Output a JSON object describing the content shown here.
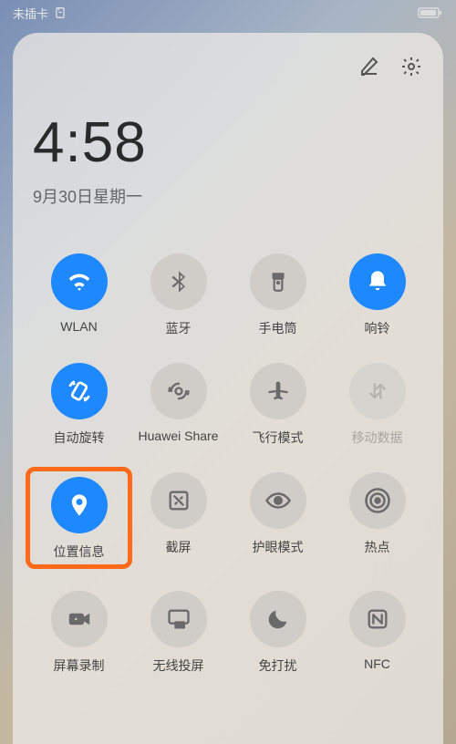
{
  "status": {
    "carrier": "未插卡",
    "battery_pct": 85
  },
  "panel": {
    "time": "4:58",
    "date": "9月30日星期一"
  },
  "toggles": [
    {
      "label": "WLAN",
      "icon": "wifi",
      "active": true,
      "dim": false,
      "highlight": false
    },
    {
      "label": "蓝牙",
      "icon": "bluetooth",
      "active": false,
      "dim": false,
      "highlight": false
    },
    {
      "label": "手电筒",
      "icon": "flashlight",
      "active": false,
      "dim": false,
      "highlight": false
    },
    {
      "label": "响铃",
      "icon": "bell",
      "active": true,
      "dim": false,
      "highlight": false
    },
    {
      "label": "自动旋转",
      "icon": "rotate",
      "active": true,
      "dim": false,
      "highlight": false
    },
    {
      "label": "Huawei Share",
      "icon": "share",
      "active": false,
      "dim": false,
      "highlight": false
    },
    {
      "label": "飞行模式",
      "icon": "airplane",
      "active": false,
      "dim": false,
      "highlight": false
    },
    {
      "label": "移动数据",
      "icon": "mobiledata",
      "active": false,
      "dim": true,
      "highlight": false
    },
    {
      "label": "位置信息",
      "icon": "location",
      "active": true,
      "dim": false,
      "highlight": true
    },
    {
      "label": "截屏",
      "icon": "screenshot",
      "active": false,
      "dim": false,
      "highlight": false
    },
    {
      "label": "护眼模式",
      "icon": "eye",
      "active": false,
      "dim": false,
      "highlight": false
    },
    {
      "label": "热点",
      "icon": "hotspot",
      "active": false,
      "dim": false,
      "highlight": false
    },
    {
      "label": "屏幕录制",
      "icon": "record",
      "active": false,
      "dim": false,
      "highlight": false
    },
    {
      "label": "无线投屏",
      "icon": "cast",
      "active": false,
      "dim": false,
      "highlight": false
    },
    {
      "label": "免打扰",
      "icon": "moon",
      "active": false,
      "dim": false,
      "highlight": false
    },
    {
      "label": "NFC",
      "icon": "nfc",
      "active": false,
      "dim": false,
      "highlight": false
    }
  ]
}
